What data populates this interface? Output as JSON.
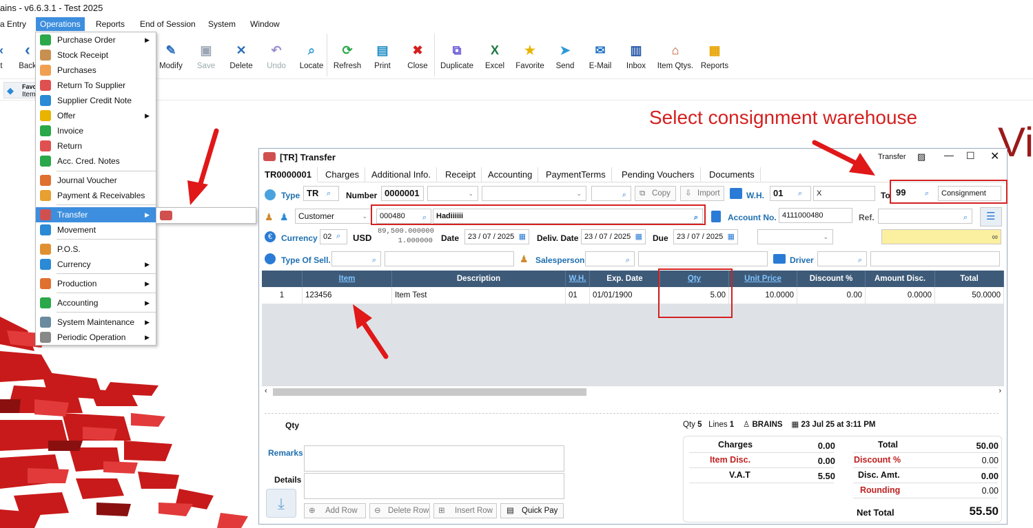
{
  "app": {
    "title": "ains - v6.6.3.1 - Test 2025"
  },
  "menubar": [
    "a Entry",
    "Operations",
    "Reports",
    "End of Session",
    "System",
    "Window"
  ],
  "toolbar": {
    "left": [
      "t",
      "Back"
    ],
    "buttons": [
      {
        "label": "Modify",
        "icon": "modify-icon",
        "color": "#2c6fbd",
        "glyph": "✎"
      },
      {
        "label": "Save",
        "icon": "save-icon",
        "color": "#9aa6b4",
        "glyph": "▣",
        "disabled": true
      },
      {
        "label": "Delete",
        "icon": "delete-icon",
        "color": "#2c6fbd",
        "glyph": "✕"
      },
      {
        "label": "Undo",
        "icon": "undo-icon",
        "color": "#9a8fd0",
        "glyph": "↶",
        "disabled": true
      },
      {
        "label": "Locate",
        "icon": "locate-icon",
        "color": "#2b9bd6",
        "glyph": "⌕"
      },
      {
        "label": "Refresh",
        "icon": "refresh-icon",
        "color": "#2aa84a",
        "glyph": "⟳"
      },
      {
        "label": "Print",
        "icon": "print-icon",
        "color": "#1c8cc4",
        "glyph": "▤"
      },
      {
        "label": "Close",
        "icon": "close-icon",
        "color": "#d42020",
        "glyph": "✖"
      },
      {
        "label": "Duplicate",
        "icon": "duplicate-icon",
        "color": "#6a5ad6",
        "glyph": "⧉"
      },
      {
        "label": "Excel",
        "icon": "excel-icon",
        "color": "#1d7a43",
        "glyph": "X"
      },
      {
        "label": "Favorite",
        "icon": "favorite-icon",
        "color": "#e8b400",
        "glyph": "★"
      },
      {
        "label": "Send",
        "icon": "send-icon",
        "color": "#2b9bd6",
        "glyph": "➤"
      },
      {
        "label": "E-Mail",
        "icon": "email-icon",
        "color": "#1c6fc4",
        "glyph": "✉"
      },
      {
        "label": "Inbox",
        "icon": "inbox-icon",
        "color": "#1c4fa4",
        "glyph": "▥"
      },
      {
        "label": "Item Qtys.",
        "icon": "item-qtys-icon",
        "color": "#c05020",
        "glyph": "⌂"
      },
      {
        "label": "Reports",
        "icon": "reports-icon",
        "color": "#e8a400",
        "glyph": "▦"
      }
    ]
  },
  "favbar": {
    "label1": "Favo",
    "label2": "Item"
  },
  "dropdown": {
    "items": [
      {
        "label": "Purchase Order",
        "arrow": true,
        "color": "#2aa84a"
      },
      {
        "label": "Stock Receipt",
        "arrow": false,
        "color": "#c89050"
      },
      {
        "label": "Purchases",
        "arrow": false,
        "color": "#f0a050"
      },
      {
        "label": "Return To Supplier",
        "arrow": false,
        "color": "#e05050"
      },
      {
        "label": "Supplier Credit Note",
        "arrow": false,
        "color": "#2a8ad6"
      },
      {
        "label": "Offer",
        "arrow": true,
        "color": "#e8b400"
      },
      {
        "label": "Invoice",
        "arrow": false,
        "color": "#2aa84a"
      },
      {
        "label": "Return",
        "arrow": false,
        "color": "#e05050"
      },
      {
        "label": "Acc. Cred. Notes",
        "arrow": false,
        "color": "#2aa84a"
      },
      {
        "label": "Journal Voucher",
        "arrow": false,
        "color": "#e07030"
      },
      {
        "label": "Payment & Receivables",
        "arrow": false,
        "color": "#e8a030"
      },
      {
        "label": "Transfer",
        "arrow": true,
        "color": "#d05050",
        "selected": true
      },
      {
        "label": "Movement",
        "arrow": false,
        "color": "#2a8ad6"
      },
      {
        "label": "P.O.S.",
        "arrow": false,
        "color": "#e09030"
      },
      {
        "label": "Currency",
        "arrow": true,
        "color": "#2a8ad6"
      },
      {
        "label": "Production",
        "arrow": true,
        "color": "#e07030"
      },
      {
        "label": "Accounting",
        "arrow": true,
        "color": "#2aa84a"
      },
      {
        "label": "System Maintenance",
        "arrow": true,
        "color": "#6a8aa0"
      },
      {
        "label": "Periodic Operation",
        "arrow": true,
        "color": "#888888"
      }
    ],
    "submenu": "Transfer"
  },
  "annotation": "Select consignment warehouse",
  "cropped_text": "Vi",
  "window": {
    "title": "[TR] Transfer",
    "title_right": "Transfer",
    "tabs": [
      "TR0000001",
      "Charges",
      "Additional Info.",
      "Receipt",
      "Accounting",
      "PaymentTerms",
      "Pending Vouchers",
      "Documents"
    ],
    "type_label": "Type",
    "type_value": "TR",
    "number_label": "Number",
    "number_value": "0000001",
    "copy": "Copy",
    "import": "Import",
    "wh_label": "W.H.",
    "wh_value": "01",
    "wh_name": "X",
    "to_label": "To",
    "to_value": "99",
    "to_name": "Consignment",
    "customer_type": "Customer",
    "customer_code": "000480",
    "customer_name": "Hadiiiiii",
    "account_label": "Account No.",
    "account_value": "4111000480",
    "ref_label": "Ref.",
    "currency_label": "Currency",
    "currency_code": "02",
    "currency_name": "USD",
    "rate1": "89,500.000000",
    "rate2": "1.000000",
    "date_label": "Date",
    "date_value": "23 / 07 / 2025",
    "deliv_label": "Deliv. Date",
    "deliv_value": "23 / 07 / 2025",
    "due_label": "Due",
    "due_value": "23 / 07 / 2025",
    "typesell_label": "Type Of Sell.",
    "salesperson_label": "Salesperson",
    "driver_label": "Driver",
    "grid": {
      "headers": [
        "",
        "Item",
        "Description",
        "W.H.",
        "Exp. Date",
        "Qty",
        "Unit Price",
        "Discount %",
        "Amount Disc.",
        "Total"
      ],
      "row": [
        "1",
        "123456",
        "Item Test",
        "01",
        "01/01/1900",
        "5.00",
        "10.0000",
        "0.00",
        "0.0000",
        "50.0000"
      ]
    },
    "footer": {
      "qty_label": "Qty",
      "status_qty_label": "Qty",
      "status_qty": "5",
      "status_lines_label": "Lines",
      "status_lines": "1",
      "user": "BRAINS",
      "timestamp": "23 Jul 25 at 3:11 PM",
      "remarks": "Remarks",
      "details": "Details",
      "add_row": "Add Row",
      "delete_row": "Delete Row",
      "insert_row": "Insert Row",
      "quick_pay": "Quick Pay",
      "charges_label": "Charges",
      "charges": "0.00",
      "itemdisc_label": "Item Disc.",
      "itemdisc": "0.00",
      "vat_label": "V.A.T",
      "vat": "5.50",
      "total_label": "Total",
      "total": "50.00",
      "discpct_label": "Discount %",
      "discpct": "0.00",
      "discamt_label": "Disc. Amt.",
      "discamt": "0.00",
      "rounding_label": "Rounding",
      "rounding": "0.00",
      "net_label": "Net Total",
      "net": "55.50"
    }
  }
}
